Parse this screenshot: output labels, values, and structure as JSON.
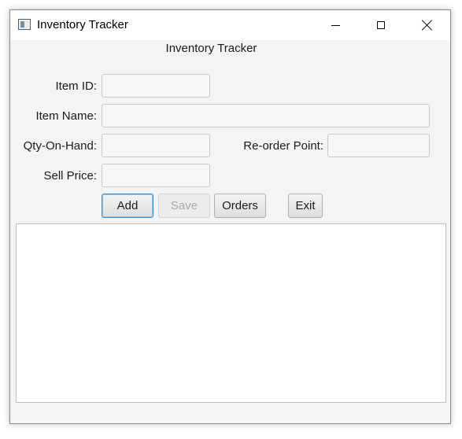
{
  "window": {
    "title": "Inventory Tracker"
  },
  "header": {
    "title": "Inventory Tracker"
  },
  "form": {
    "item_id": {
      "label": "Item ID:",
      "value": ""
    },
    "item_name": {
      "label": "Item Name:",
      "value": ""
    },
    "qty_on_hand": {
      "label": "Qty-On-Hand:",
      "value": ""
    },
    "reorder_point": {
      "label": "Re-order Point:",
      "value": ""
    },
    "sell_price": {
      "label": "Sell Price:",
      "value": ""
    }
  },
  "buttons": {
    "add": "Add",
    "save": "Save",
    "orders": "Orders",
    "exit": "Exit"
  },
  "output": {
    "text": ""
  },
  "icons": {
    "app": "app-window-icon",
    "minimize": "minimize-icon",
    "maximize": "maximize-icon",
    "close": "close-icon"
  },
  "colors": {
    "window_bg": "#f4f4f4",
    "focus_border": "#2e8fd6",
    "disabled_text": "#a8a8a8"
  }
}
